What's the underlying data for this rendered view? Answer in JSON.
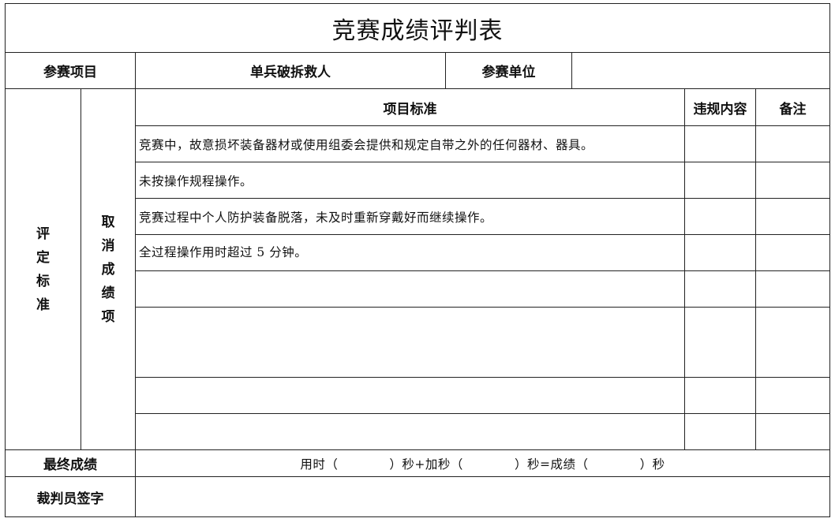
{
  "title": "竞赛成绩评判表",
  "header": {
    "project_label": "参赛项目",
    "project_value": "单兵破拆救人",
    "unit_label": "参赛单位",
    "unit_value": ""
  },
  "criteria": {
    "side_label_chars": [
      "评",
      "定",
      "标",
      "准"
    ],
    "cancel_label_chars": [
      "取",
      "消",
      "成",
      "绩",
      "项"
    ],
    "col_standard": "项目标准",
    "col_violation": "违规内容",
    "col_notes": "备注",
    "rows": [
      "竞赛中，故意损坏装备器材或使用组委会提供和规定自带之外的任何器材、器具。",
      "未按操作规程操作。",
      "竞赛过程中个人防护装备脱落，未及时重新穿戴好而继续操作。",
      "全过程操作用时超过 5 分钟。",
      "",
      "",
      "",
      ""
    ]
  },
  "final": {
    "label": "最终成绩",
    "formula": "用时（            ）秒+加秒（            ）秒=成绩（            ）秒"
  },
  "referee": {
    "label": "裁判员签字",
    "value": ""
  }
}
